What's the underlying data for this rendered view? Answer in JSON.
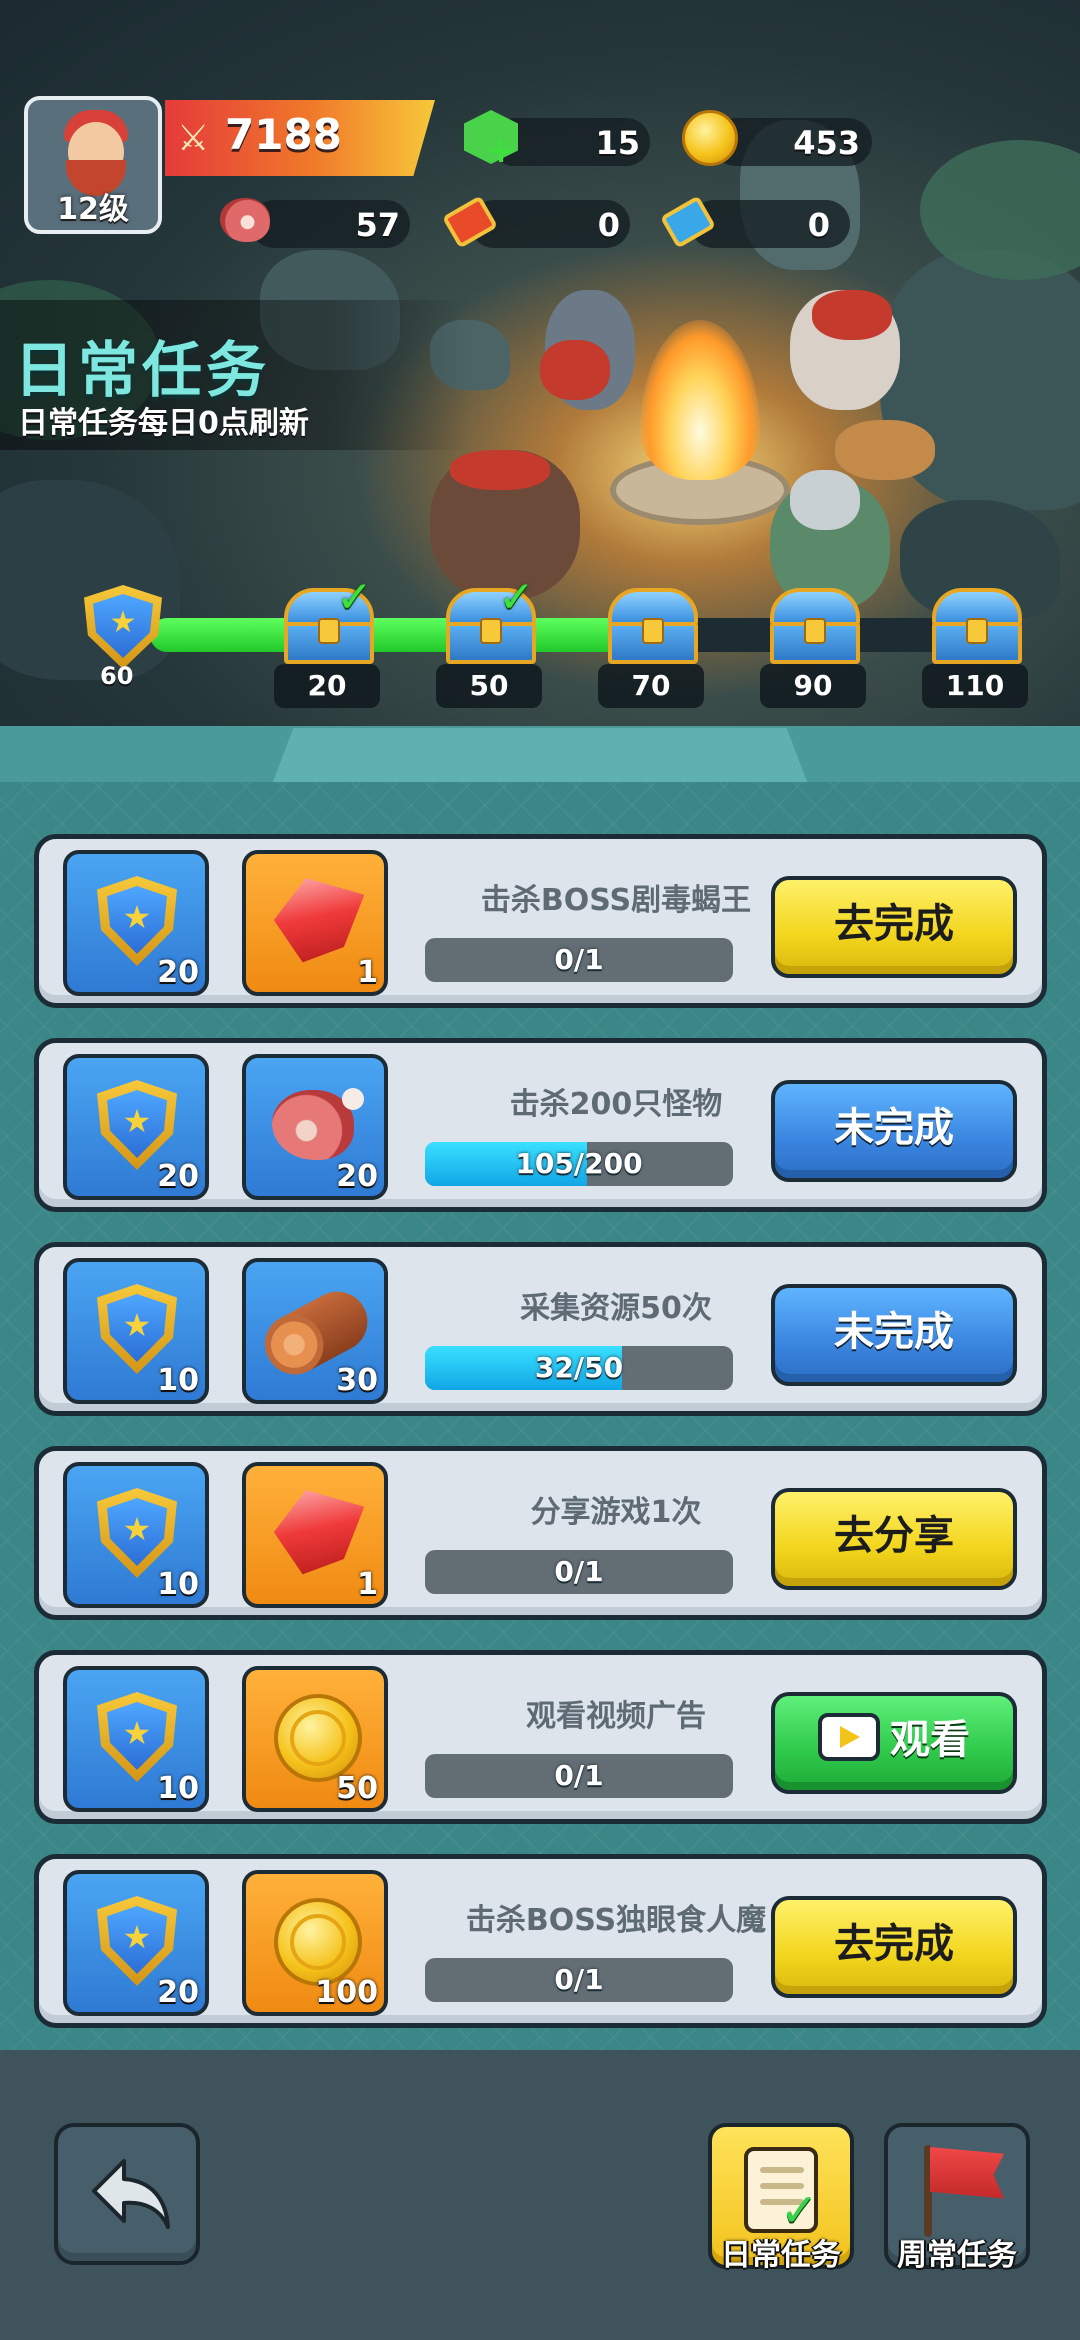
{
  "player": {
    "level_label": "12级",
    "power": "7188",
    "gems": "15",
    "coins": "453",
    "meat": "57",
    "red_tickets": "0",
    "blue_tickets": "0"
  },
  "header": {
    "title": "日常任务",
    "subtitle": "日常任务每日0点刷新"
  },
  "progress": {
    "current_points": "60",
    "max_points": 110,
    "fill_fraction": 0.6,
    "milestones": [
      {
        "points": "20",
        "claimed": true
      },
      {
        "points": "50",
        "claimed": true
      },
      {
        "points": "70",
        "claimed": false
      },
      {
        "points": "90",
        "claimed": false
      },
      {
        "points": "110",
        "claimed": false
      }
    ]
  },
  "tasks": [
    {
      "title": "击杀BOSS剧毒蝎王",
      "points": "20",
      "reward_icon": "ruby-icon",
      "reward_count": "1",
      "progress_text": "0/1",
      "progress_fraction": 0,
      "button_label": "去完成",
      "button_style": "yellow"
    },
    {
      "title": "击杀200只怪物",
      "points": "20",
      "reward_icon": "meat-icon",
      "reward_count": "20",
      "progress_text": "105/200",
      "progress_fraction": 0.525,
      "button_label": "未完成",
      "button_style": "blue"
    },
    {
      "title": "采集资源50次",
      "points": "10",
      "reward_icon": "wood-log-icon",
      "reward_count": "30",
      "progress_text": "32/50",
      "progress_fraction": 0.64,
      "button_label": "未完成",
      "button_style": "blue"
    },
    {
      "title": "分享游戏1次",
      "points": "10",
      "reward_icon": "ruby-icon",
      "reward_count": "1",
      "progress_text": "0/1",
      "progress_fraction": 0,
      "button_label": "去分享",
      "button_style": "yellow"
    },
    {
      "title": "观看视频广告",
      "points": "10",
      "reward_icon": "coin-icon",
      "reward_count": "50",
      "progress_text": "0/1",
      "progress_fraction": 0,
      "button_label": "观看",
      "button_style": "green"
    },
    {
      "title": "击杀BOSS独眼食人魔",
      "points": "20",
      "reward_icon": "coin-icon",
      "reward_count": "100",
      "progress_text": "0/1",
      "progress_fraction": 0,
      "button_label": "去完成",
      "button_style": "yellow"
    }
  ],
  "nav": {
    "daily_label": "日常任务",
    "weekly_label": "周常任务"
  },
  "colors": {
    "panel_bg": "#3b8687",
    "progress_green": "#22c92a",
    "progress_cyan": "#11a6e6",
    "button_yellow": "#f2d51c",
    "button_blue": "#3a85e0",
    "button_green": "#2ec84a"
  }
}
